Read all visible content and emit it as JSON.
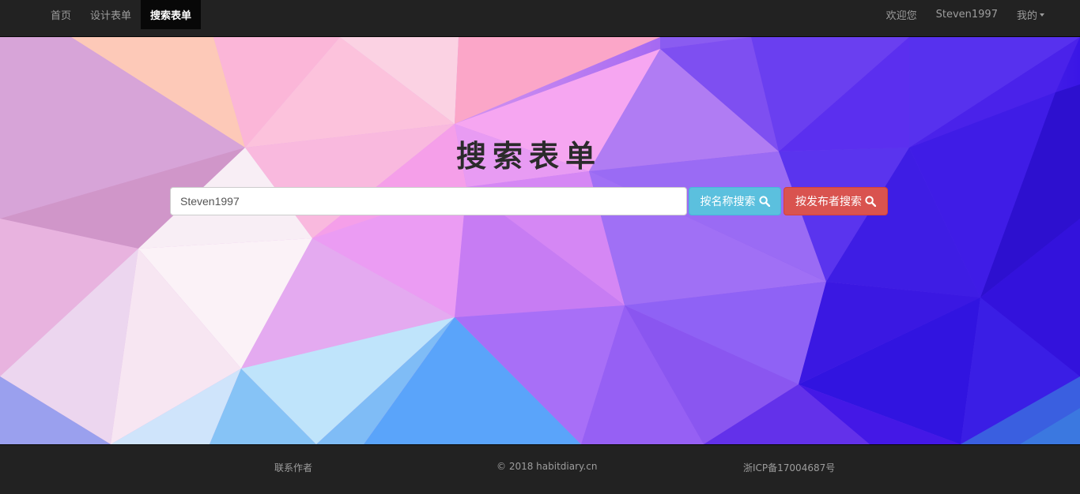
{
  "navbar": {
    "left_items": [
      {
        "label": "首页",
        "active": false
      },
      {
        "label": "设计表单",
        "active": false
      },
      {
        "label": "搜索表单",
        "active": true
      }
    ],
    "welcome": "欢迎您",
    "username": "Steven1997",
    "my_menu": "我的"
  },
  "hero": {
    "title": "搜索表单",
    "search_value": "Steven1997",
    "btn_by_name": "按名称搜索",
    "btn_by_author": "按发布者搜索"
  },
  "footer": {
    "contact": "联系作者",
    "copyright": "© 2018 habitdiary.cn",
    "icp": "浙ICP备17004687号"
  },
  "colors": {
    "navbar_bg": "#222222",
    "nav_active_bg": "#080808",
    "btn_info": "#5bc0de",
    "btn_danger": "#d9534f"
  },
  "icons": {
    "search": "search-icon",
    "caret": "caret-down-icon"
  }
}
